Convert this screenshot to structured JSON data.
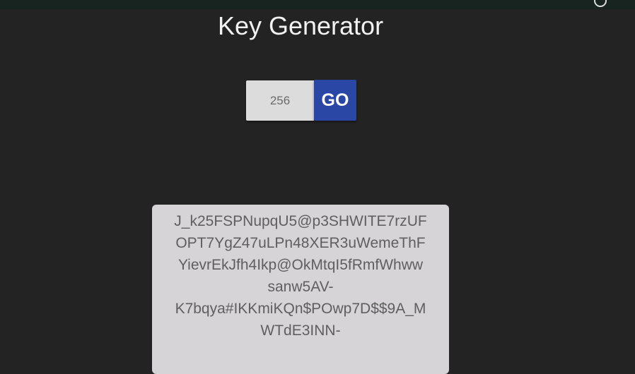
{
  "app": {
    "title": "Key Generator"
  },
  "controls": {
    "length_value": "256",
    "go_label": "GO"
  },
  "output": {
    "lines": [
      "J_k25FSPNupqU5@p3SHWITE7rzUF",
      "OPT7YgZ47uLPn48XER3uWemeThF",
      "YievrEkJfh4Ikp@OkMtqI5fRmfWhww",
      "sanw5AV-",
      "K7bqya#IKKmiKQn$POwp7D$$9A_M",
      "WTdE3INN-"
    ]
  },
  "colors": {
    "background": "#222322",
    "status_bar": "#182420",
    "go_button": "#2a47a6",
    "input_background": "#dcdcdc",
    "output_background": "#d6d4d6"
  },
  "icons": {
    "status_icon": "status-circle-icon"
  }
}
